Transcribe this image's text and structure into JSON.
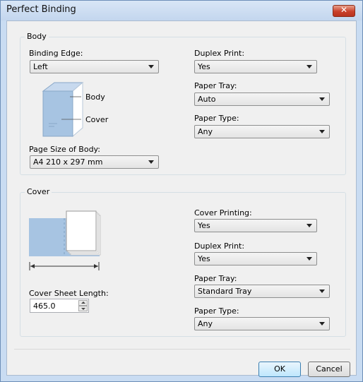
{
  "window": {
    "title": "Perfect Binding",
    "close_glyph": "✕"
  },
  "body_group": {
    "label": "Body",
    "binding_edge": {
      "label": "Binding Edge:",
      "value": "Left"
    },
    "book_illustration": {
      "body_label": "Body",
      "cover_label": "Cover"
    },
    "page_size": {
      "label": "Page Size of Body:",
      "value": "A4 210 x 297 mm"
    },
    "duplex_print": {
      "label": "Duplex Print:",
      "value": "Yes"
    },
    "paper_tray": {
      "label": "Paper Tray:",
      "value": "Auto"
    },
    "paper_type": {
      "label": "Paper Type:",
      "value": "Any"
    }
  },
  "cover_group": {
    "label": "Cover",
    "cover_sheet_length": {
      "label": "Cover Sheet Length:",
      "value": "465.0"
    },
    "cover_printing": {
      "label": "Cover Printing:",
      "value": "Yes"
    },
    "duplex_print": {
      "label": "Duplex Print:",
      "value": "Yes"
    },
    "paper_tray": {
      "label": "Paper Tray:",
      "value": "Standard Tray"
    },
    "paper_type": {
      "label": "Paper Type:",
      "value": "Any"
    }
  },
  "buttons": {
    "ok": "OK",
    "cancel": "Cancel"
  },
  "colors": {
    "illustration_blue": "#a7c4e2",
    "default_button_border": "#3c7fb1"
  },
  "icons": [
    "close-icon",
    "chevron-down-icon",
    "book-icon",
    "cover-sheet-icon",
    "spin-up-icon",
    "spin-down-icon"
  ]
}
